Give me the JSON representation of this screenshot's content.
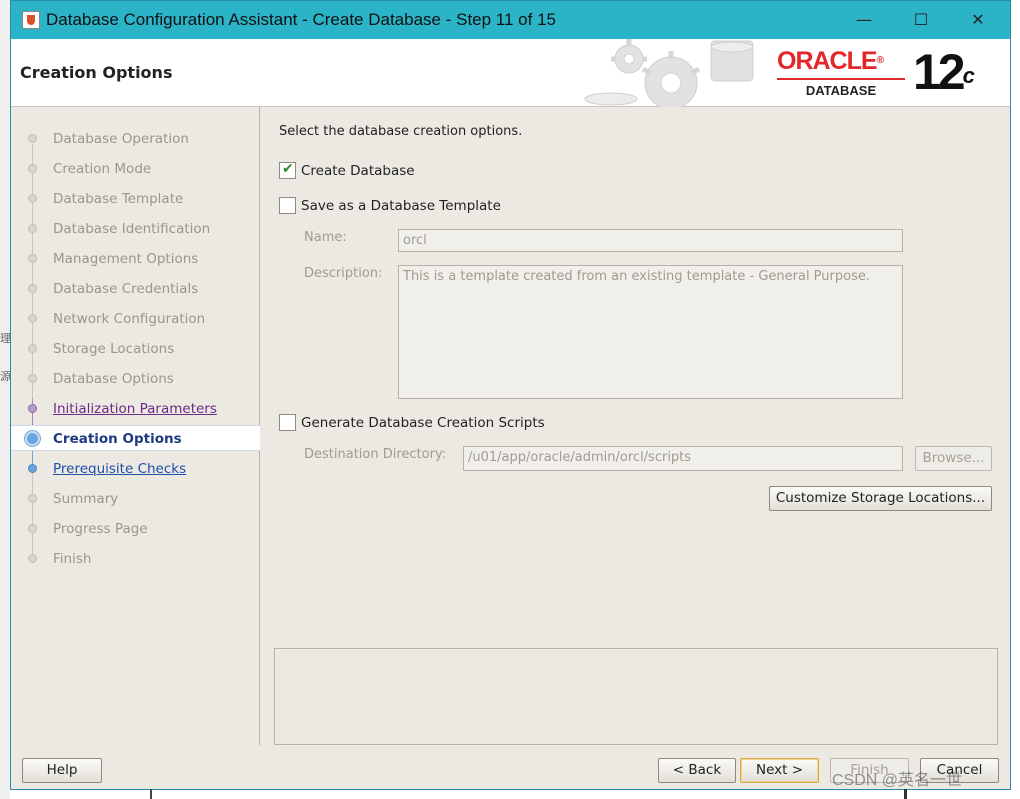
{
  "window": {
    "title": "Database Configuration Assistant - Create Database - Step 11 of 15",
    "minimize_glyph": "—",
    "maximize_glyph": "☐",
    "close_glyph": "✕"
  },
  "header": {
    "page_title": "Creation Options",
    "logo_word": "ORACLE",
    "logo_registered": "®",
    "logo_subtitle": "DATABASE",
    "version_number": "12",
    "version_suffix": "c"
  },
  "steps": [
    {
      "label": "Database Operation",
      "state": "done"
    },
    {
      "label": "Creation Mode",
      "state": "done"
    },
    {
      "label": "Database Template",
      "state": "done"
    },
    {
      "label": "Database Identification",
      "state": "done"
    },
    {
      "label": "Management Options",
      "state": "done"
    },
    {
      "label": "Database Credentials",
      "state": "done"
    },
    {
      "label": "Network Configuration",
      "state": "done"
    },
    {
      "label": "Storage Locations",
      "state": "done"
    },
    {
      "label": "Database Options",
      "state": "done"
    },
    {
      "label": "Initialization Parameters",
      "state": "visited"
    },
    {
      "label": "Creation Options",
      "state": "current"
    },
    {
      "label": "Prerequisite Checks",
      "state": "link"
    },
    {
      "label": "Summary",
      "state": "pending"
    },
    {
      "label": "Progress Page",
      "state": "pending"
    },
    {
      "label": "Finish",
      "state": "pending"
    }
  ],
  "content": {
    "instruction": "Select the database creation options.",
    "create_database": {
      "label": "Create Database",
      "checked": true
    },
    "save_template": {
      "label": "Save as a Database Template",
      "checked": false
    },
    "name_label": "Name:",
    "name_value": "orcl",
    "description_label": "Description:",
    "description_value": "This is a template created from an existing template - General Purpose.",
    "generate_scripts": {
      "label": "Generate Database Creation Scripts",
      "checked": false
    },
    "destination_label": "Destination Directory:",
    "destination_value": "/u01/app/oracle/admin/orcl/scripts",
    "browse_label": "Browse...",
    "customize_label": "Customize Storage Locations..."
  },
  "footer": {
    "help_label": "Help",
    "back_label": "< Back",
    "next_label": "Next >",
    "finish_label": "Finish",
    "cancel_label": "Cancel"
  },
  "watermark": "CSDN @英名一世",
  "colors": {
    "titlebar": "#2bb3c8",
    "oracle_red": "#e3262a",
    "current_step": "#1f3a82",
    "visited_step": "#6d2a87",
    "link_step": "#1f4fa8",
    "panel_bg": "#ece9e2"
  }
}
